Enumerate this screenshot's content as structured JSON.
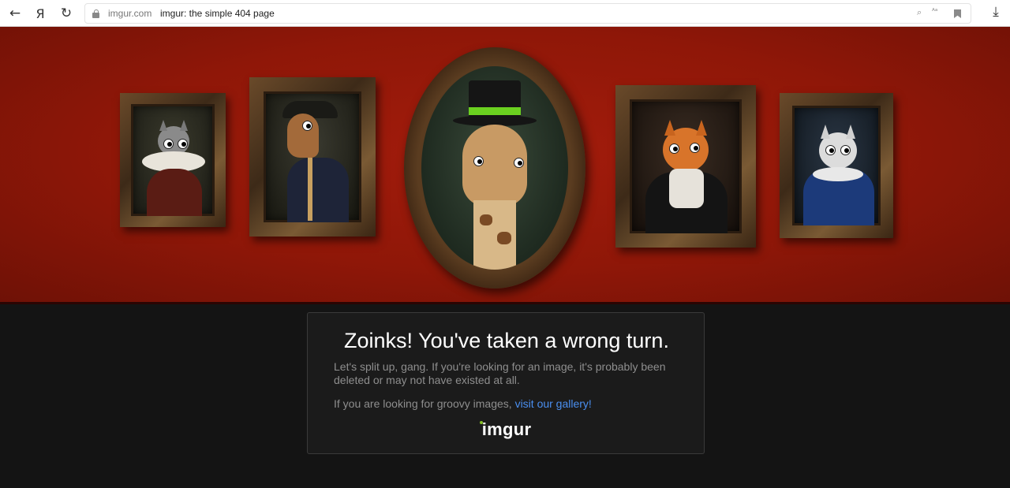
{
  "browser": {
    "domain": "imgur.com",
    "tab_title": "imgur: the simple 404 page",
    "back_icon": "←",
    "yandex_icon": "Я",
    "reload_icon": "↻",
    "download_icon": "⤓",
    "reader_icon": "⌕",
    "translate_icon": "ᴬᵃ"
  },
  "hero": {
    "background_color": "#9a1a0a",
    "portraits": [
      {
        "name": "cat-ruff-portrait",
        "bg": "#2a2a20",
        "subject": "#8a8a8a"
      },
      {
        "name": "horse-admiral-portrait",
        "bg": "#262620",
        "subject": "#a36a3a"
      },
      {
        "name": "giraffe-tophat-portrait",
        "bg": "#1d2a1f",
        "subject": "#c89a64"
      },
      {
        "name": "orange-cat-portrait",
        "bg": "#241c16",
        "subject": "#d8742a"
      },
      {
        "name": "white-cat-portrait",
        "bg": "#1a2330",
        "subject": "#dcdcdc"
      }
    ]
  },
  "message": {
    "title": "Zoinks! You've taken a wrong turn.",
    "body": "Let's split up, gang. If you're looking for an image, it's probably been deleted or may not have existed at all.",
    "gallery_prefix": "If you are looking for groovy images, ",
    "gallery_link": "visit our gallery!",
    "logo_text": "imgur",
    "link_color": "#4a8ff0",
    "logo_dot_color": "#85bf25"
  }
}
